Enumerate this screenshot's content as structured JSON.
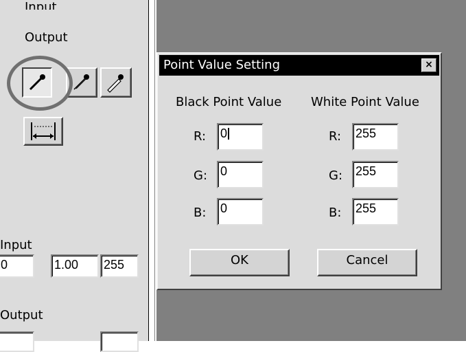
{
  "left_panel": {
    "input_label_top": "Input",
    "output_label": "Output",
    "input_label_bottom": "Input",
    "input_values": [
      "0",
      "1.00",
      "255"
    ],
    "output_label_bottom": "Output",
    "tools": [
      {
        "name": "black-point-eyedropper"
      },
      {
        "name": "gray-point-eyedropper"
      },
      {
        "name": "white-point-eyedropper"
      },
      {
        "name": "auto-level-button"
      }
    ]
  },
  "dialog": {
    "title": "Point Value Setting",
    "close_glyph": "×",
    "black_header": "Black Point Value",
    "white_header": "White Point Value",
    "labels": [
      "R:",
      "G:",
      "B:"
    ],
    "black": {
      "r": "0",
      "g": "0",
      "b": "0"
    },
    "white": {
      "r": "255",
      "g": "255",
      "b": "255"
    },
    "ok_label": "OK",
    "cancel_label": "Cancel"
  }
}
